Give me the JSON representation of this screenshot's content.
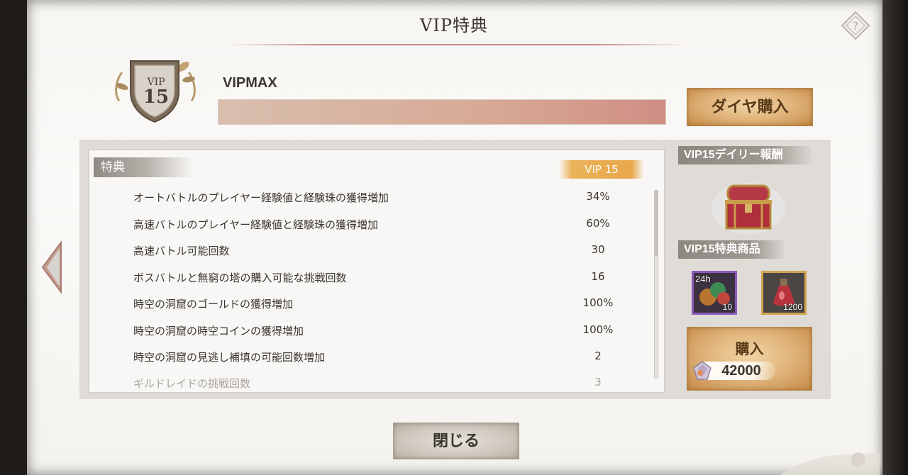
{
  "header": {
    "title": "VIP特典"
  },
  "vip": {
    "badge_text": "VIP",
    "level": "15",
    "status_label": "VIPMAX",
    "progress": 1.0
  },
  "buttons": {
    "diamond_purchase": "ダイヤ購入",
    "close": "閉じる",
    "buy": "購入"
  },
  "benefits": {
    "header": "特典",
    "level_tag": "VIP 15",
    "rows": [
      {
        "name": "オートバトルのプレイヤー経験値と経験珠の獲得増加",
        "value": "34%"
      },
      {
        "name": "高速バトルのプレイヤー経験値と経験珠の獲得増加",
        "value": "60%"
      },
      {
        "name": "高速バトル可能回数",
        "value": "30"
      },
      {
        "name": "ボスバトルと無窮の塔の購入可能な挑戦回数",
        "value": "16"
      },
      {
        "name": "時空の洞窟のゴールドの獲得増加",
        "value": "100%"
      },
      {
        "name": "時空の洞窟の時空コインの獲得増加",
        "value": "100%"
      },
      {
        "name": "時空の洞窟の見逃し補填の可能回数増加",
        "value": "2"
      },
      {
        "name": "ギルドレイドの挑戦回数",
        "value": "3"
      }
    ]
  },
  "side": {
    "daily_reward_label": "VIP15デイリー報酬",
    "shop_label": "VIP15特典商品",
    "items": [
      {
        "time_tag": "24h",
        "count": "10"
      },
      {
        "count": "1200"
      }
    ],
    "price": "42000"
  },
  "colors": {
    "accent_gold": "#e2b77f",
    "progress_fill": "#d08e84",
    "item_rare_border": "#8a5ab8",
    "item_gold_border": "#d1a451"
  }
}
